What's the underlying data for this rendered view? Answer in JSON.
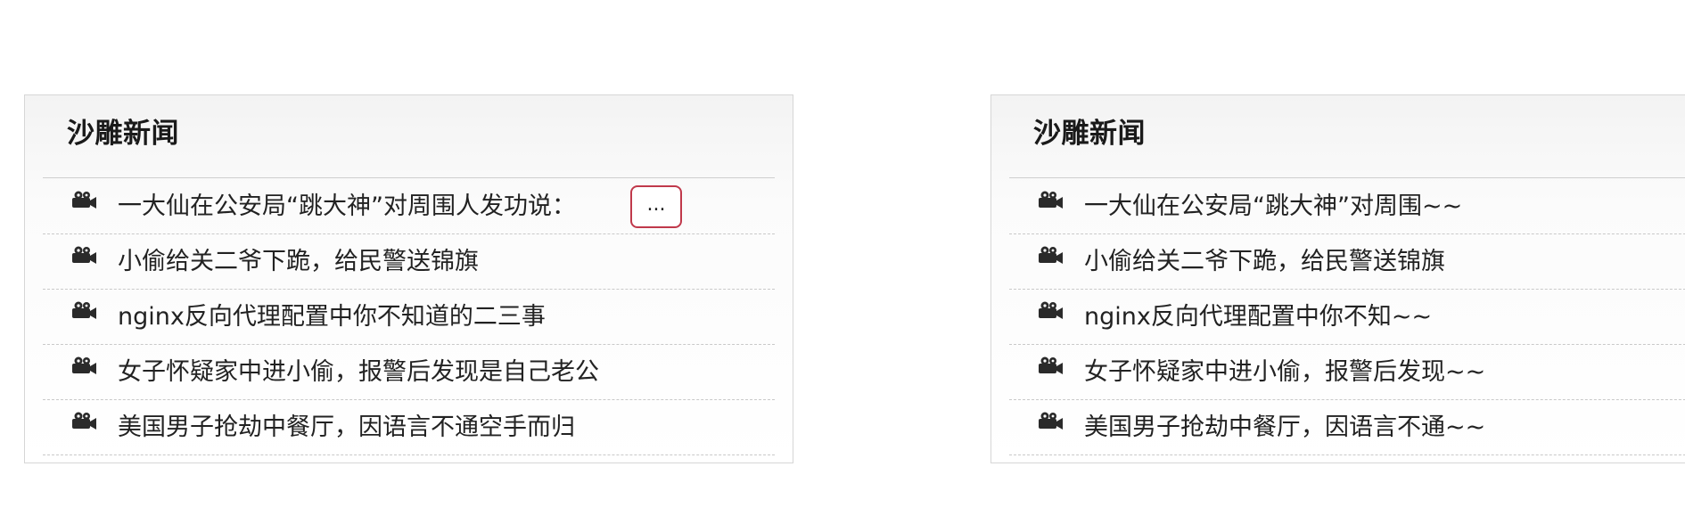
{
  "left_panel": {
    "title": "沙雕新闻",
    "items": [
      {
        "text": "一大仙在公安局“跳大神”对周围人发功说："
      },
      {
        "text": "小偷给关二爷下跪，给民警送锦旗"
      },
      {
        "text": "nginx反向代理配置中你不知道的二三事"
      },
      {
        "text": "女子怀疑家中进小偷，报警后发现是自己老公"
      },
      {
        "text": "美国男子抢劫中餐厅，因语言不通空手而归"
      }
    ],
    "more_label": "..."
  },
  "right_panel": {
    "title": "沙雕新闻",
    "items": [
      {
        "text": "一大仙在公安局“跳大神”对周围~~"
      },
      {
        "text": "小偷给关二爷下跪，给民警送锦旗"
      },
      {
        "text": "nginx反向代理配置中你不知~~"
      },
      {
        "text": "女子怀疑家中进小偷，报警后发现~~"
      },
      {
        "text": "美国男子抢劫中餐厅，因语言不通~~"
      }
    ]
  },
  "icon": "video-camera-icon",
  "colors": {
    "highlight_border": "#c0394b",
    "divider": "#c9c9c9",
    "text": "#222222"
  }
}
